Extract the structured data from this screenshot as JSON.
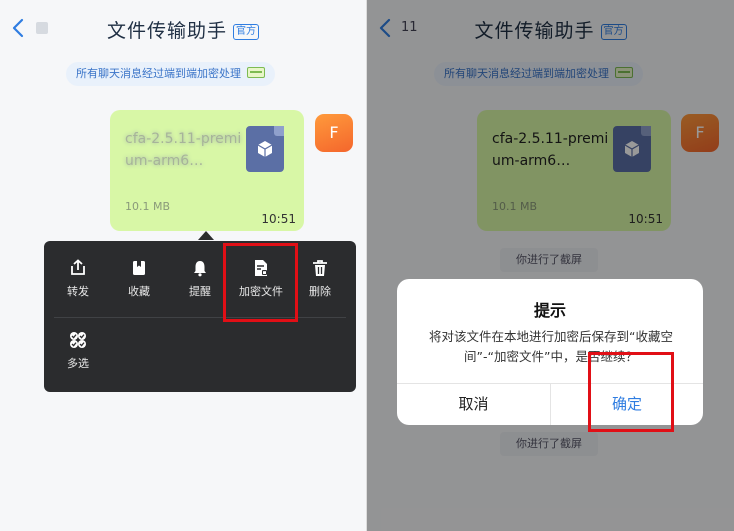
{
  "left": {
    "header": {
      "title": "文件传输助手",
      "tag": "官方"
    },
    "encryption_notice": "所有聊天消息经过端到端加密处理",
    "avatar_letter": "F",
    "file": {
      "name": "cfa-2.5.11-premium-arm6…",
      "size": "10.1 MB",
      "time": "10:51"
    },
    "menu": {
      "forward": "转发",
      "favorite": "收藏",
      "remind": "提醒",
      "encrypt": "加密文件",
      "delete": "删除",
      "multi_select": "多选"
    }
  },
  "right": {
    "header": {
      "back_count": "11",
      "title": "文件传输助手",
      "tag": "官方"
    },
    "encryption_notice": "所有聊天消息经过端到端加密处理",
    "avatar_letter": "F",
    "file": {
      "name": "cfa-2.5.11-premium-arm6…",
      "size": "10.1 MB",
      "time": "10:51"
    },
    "system_message": "你进行了截屏",
    "dialog": {
      "title": "提示",
      "message": "将对该文件在本地进行加密后保存到“收藏空间”-“加密文件”中，是否继续？",
      "cancel": "取消",
      "confirm": "确定"
    }
  },
  "colors": {
    "accent": "#2f7de1",
    "highlight": "#e10f16",
    "bubble": "#d8f7a6",
    "menu_bg": "#2b2c2e"
  }
}
